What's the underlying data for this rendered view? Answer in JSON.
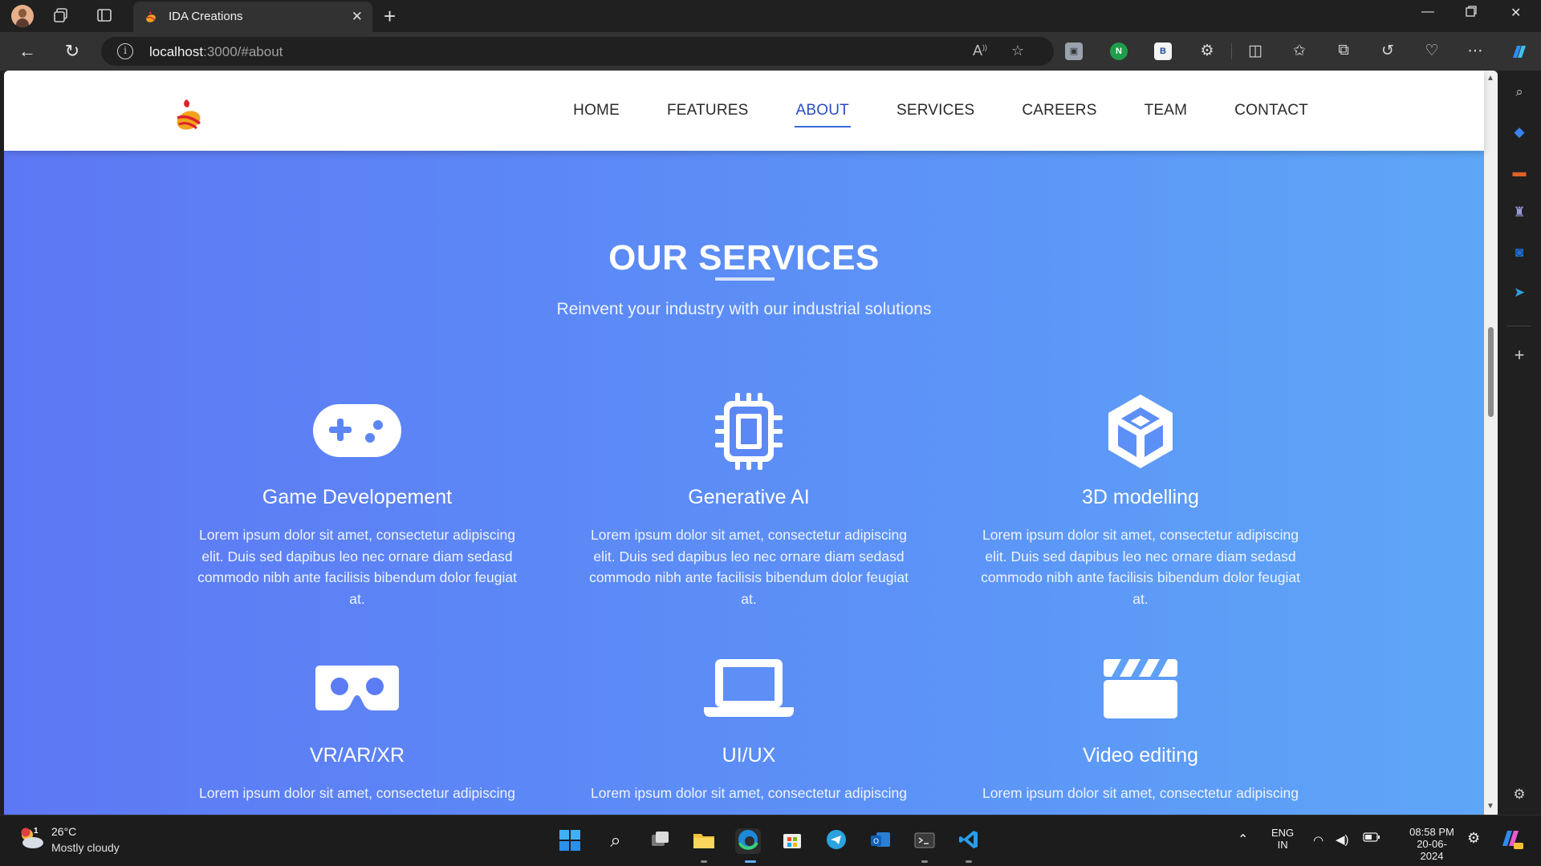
{
  "browser": {
    "tab_title": "IDA Creations",
    "url_host": "localhost",
    "url_rest": ":3000/#about"
  },
  "site": {
    "nav": [
      {
        "label": "HOME"
      },
      {
        "label": "FEATURES"
      },
      {
        "label": "ABOUT",
        "active": true
      },
      {
        "label": "SERVICES"
      },
      {
        "label": "CAREERS"
      },
      {
        "label": "TEAM"
      },
      {
        "label": "CONTACT"
      }
    ],
    "section": {
      "title": "OUR SERVICES",
      "subtitle": "Reinvent your industry with our industrial solutions"
    },
    "services": [
      {
        "icon": "gamepad-icon",
        "title": "Game Developement",
        "desc": "Lorem ipsum dolor sit amet, consectetur adipiscing elit. Duis sed dapibus leo nec ornare diam sedasd commodo nibh ante facilisis bibendum dolor feugiat at."
      },
      {
        "icon": "chip-icon",
        "title": "Generative AI",
        "desc": "Lorem ipsum dolor sit amet, consectetur adipiscing elit. Duis sed dapibus leo nec ornare diam sedasd commodo nibh ante facilisis bibendum dolor feugiat at."
      },
      {
        "icon": "unity-cube-icon",
        "title": "3D modelling",
        "desc": "Lorem ipsum dolor sit amet, consectetur adipiscing elit. Duis sed dapibus leo nec ornare diam sedasd commodo nibh ante facilisis bibendum dolor feugiat at."
      },
      {
        "icon": "vr-headset-icon",
        "title": "VR/AR/XR",
        "desc": "Lorem ipsum dolor sit amet, consectetur adipiscing"
      },
      {
        "icon": "laptop-icon",
        "title": "UI/UX",
        "desc": "Lorem ipsum dolor sit amet, consectetur adipiscing"
      },
      {
        "icon": "clapperboard-icon",
        "title": "Video editing",
        "desc": "Lorem ipsum dolor sit amet, consectetur adipiscing"
      }
    ]
  },
  "taskbar": {
    "weather_badge": "1",
    "temperature": "26°C",
    "weather": "Mostly cloudy",
    "lang_top": "ENG",
    "lang_bottom": "IN",
    "time": "08:58 PM",
    "date": "20-06-2024"
  },
  "colors": {
    "gradient_start": "#5d78f4",
    "gradient_end": "#5ea6f7",
    "nav_active": "#2a4cc0"
  }
}
